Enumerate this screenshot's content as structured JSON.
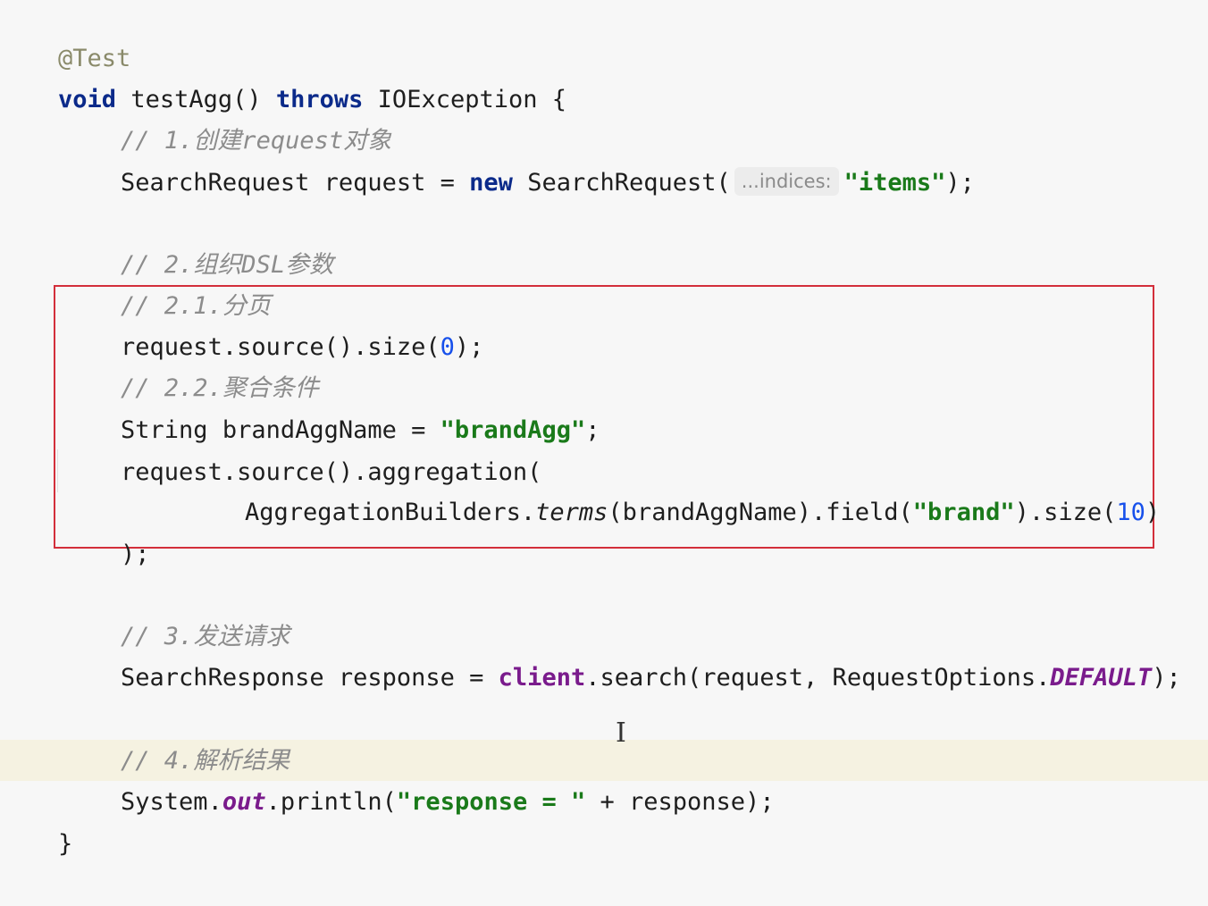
{
  "editor": {
    "annotation": "@Test",
    "method_sig": {
      "kw_void": "void",
      "name": " testAgg() ",
      "kw_throws": "throws",
      "rest": " IOException {"
    },
    "comment_1": "// 1.创建request对象",
    "line_request": {
      "p1": "SearchRequest request = ",
      "kw_new": "new",
      "p2": " SearchRequest(",
      "hint": "...indices:",
      "str": "\"items\"",
      "p3": ");"
    },
    "comment_2": "// 2.组织DSL参数",
    "comment_2_1": "// 2.1.分页",
    "line_size": {
      "p1": "request.source().size(",
      "num": "0",
      "p2": ");"
    },
    "comment_2_2": "// 2.2.聚合条件",
    "line_name": {
      "p1": "String brandAggName = ",
      "str": "\"brandAgg\"",
      "p2": ";"
    },
    "line_agg": "request.source().aggregation(",
    "line_terms": {
      "p1": "AggregationBuilders.",
      "method": "terms",
      "p2": "(brandAggName).field(",
      "str": "\"brand\"",
      "p3": ").size(",
      "num": "10",
      "p4": ")"
    },
    "line_close": ");",
    "comment_3": "// 3.发送请求",
    "line_search": {
      "p1": "SearchResponse response = ",
      "client": "client",
      "p2": ".search(request, RequestOptions.",
      "default": "DEFAULT",
      "p3": ");"
    },
    "comment_4": "// 4.解析结果",
    "line_print": {
      "p1": "System.",
      "out": "out",
      "p2": ".println(",
      "str": "\"response = \"",
      "p3": " + response);"
    },
    "closing_brace": "}"
  },
  "colors": {
    "highlight_box": "#d32f3b",
    "current_line": "#f5f2e1",
    "keyword": "#0b2a8a",
    "string": "#1a7a1a",
    "number": "#1750eb",
    "field": "#7a1b8c"
  },
  "cursor_icon": "text-cursor-icon"
}
